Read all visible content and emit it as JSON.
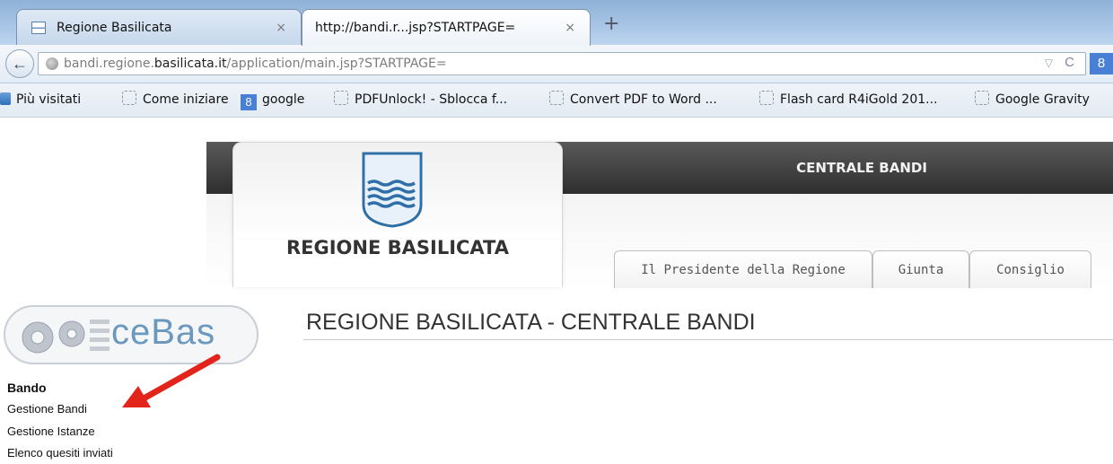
{
  "browser": {
    "tabs": [
      {
        "label": "Regione Basilicata",
        "close": "×"
      },
      {
        "label": "http://bandi.r...jsp?STARTPAGE=",
        "close": "×"
      }
    ],
    "new_tab": "+",
    "url_host_prefix": "bandi.regione.",
    "url_host_bold": "basilicata.it",
    "url_path": "/application/main.jsp?STARTPAGE=",
    "dropdown_glyph": "▽",
    "reload_glyph": "C",
    "search_engine_glyph": "8",
    "bookmarks": [
      {
        "label": "Più visitati",
        "icon": "folder-icon"
      },
      {
        "label": "Come iniziare",
        "icon": "blank-page-icon"
      },
      {
        "label": "google",
        "icon": "google-icon",
        "glyph": "8"
      },
      {
        "label": "PDFUnlock! - Sblocca f...",
        "icon": "blank-page-icon"
      },
      {
        "label": "Convert PDF to Word ...",
        "icon": "blank-page-icon"
      },
      {
        "label": "Flash card R4iGold 201...",
        "icon": "blank-page-icon"
      },
      {
        "label": "Google Gravity",
        "icon": "blank-page-icon"
      }
    ]
  },
  "header": {
    "org_name": "REGIONE BASILICATA",
    "banner": "CENTRALE BANDI",
    "tabs": [
      "Il Presidente della Regione",
      "Giunta",
      "Consiglio"
    ]
  },
  "content": {
    "logo_text": "ceBas",
    "title": "REGIONE BASILICATA - CENTRALE BANDI",
    "menu_heading": "Bando",
    "menu_items": [
      "Gestione Bandi",
      "Gestione Istanze",
      "Elenco quesiti inviati"
    ]
  },
  "colors": {
    "arrow": "#e3241b",
    "logo_blue": "#6a98bf"
  }
}
